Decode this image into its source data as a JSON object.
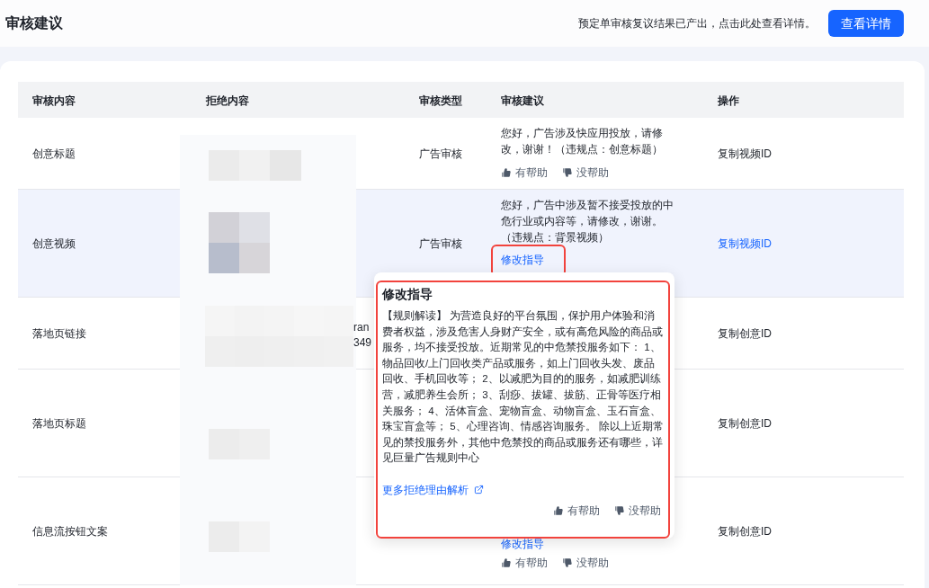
{
  "header": {
    "title": "审核建议",
    "notice": "预定单审核复议结果已产出，点击此处查看详情。",
    "button": "查看详情"
  },
  "table": {
    "columns": [
      "审核内容",
      "拒绝内容",
      "审核类型",
      "审核建议",
      "操作"
    ],
    "rows": [
      {
        "content": "创意标题",
        "highlighted": false,
        "rejected": {
          "kind": "pixelated_image"
        },
        "review_type": "广告审核",
        "suggestion": {
          "text": "您好，广告涉及快应用投放，请修改，谢谢！（违规点：创意标题）",
          "feedback": [
            "有帮助",
            "没帮助"
          ]
        },
        "action": "复制视频ID"
      },
      {
        "content": "创意视频",
        "highlighted": true,
        "rejected": {
          "kind": "pixelated_image"
        },
        "review_type": "广告审核",
        "suggestion": {
          "text": "您好，广告中涉及暂不接受投放的中危行业或内容等，请修改，谢谢。（违规点：背景视频）",
          "guide_link": "修改指导",
          "guide_highlighted": true
        },
        "action": "复制视频ID"
      },
      {
        "content": "落地页链接",
        "highlighted": false,
        "rejected": {
          "kind": "pixelated_text",
          "visible_text": [
            "ran",
            "349"
          ]
        },
        "action": "复制创意ID"
      },
      {
        "content": "落地页标题",
        "highlighted": false,
        "rejected": {
          "kind": "pixelated_image"
        },
        "action": "复制创意ID"
      },
      {
        "content": "信息流按钮文案",
        "highlighted": false,
        "rejected": {
          "kind": "pixelated_image"
        },
        "suggestion": {
          "guide_link": "修改指导",
          "feedback": [
            "有帮助",
            "没帮助"
          ]
        },
        "action": "复制创意ID"
      }
    ]
  },
  "popup": {
    "title": "修改指导",
    "highlighted": true,
    "body": "【规则解读】 为营造良好的平台氛围，保护用户体验和消费者权益，涉及危害人身财产安全，或有高危风险的商品或服务，均不接受投放。近期常见的中危禁投服务如下： 1、物品回收/上门回收类产品或服务，如上门回收头发、废品回收、手机回收等； 2、以减肥为目的的服务，如减肥训练营，减肥养生会所； 3、刮痧、拔罐、拔筋、正骨等医疗相关服务； 4、活体盲盒、宠物盲盒、动物盲盒、玉石盲盒、珠宝盲盒等； 5、心理咨询、情感咨询服务。 除以上近期常见的禁投服务外，其他中危禁投的商品或服务还有哪些，详见巨量广告规则中心",
    "link": "更多拒绝理由解析",
    "feedback": [
      "有帮助",
      "没帮助"
    ]
  }
}
